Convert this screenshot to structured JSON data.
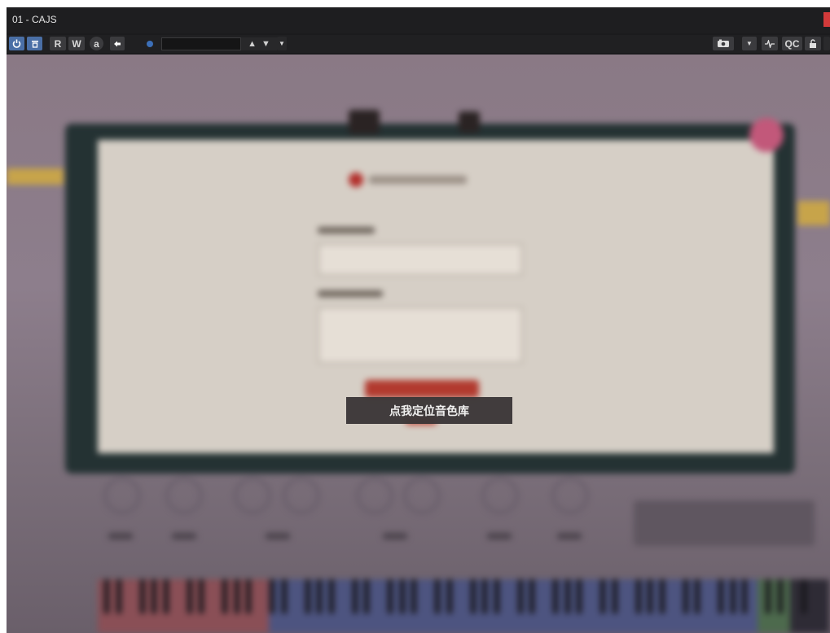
{
  "window": {
    "title": "01 - CAJS"
  },
  "toolbar": {
    "left_buttons": [
      {
        "name": "power-button",
        "icon": "power-icon"
      },
      {
        "name": "bypass-button",
        "icon": "bypass-icon"
      },
      {
        "name": "read-automation-button",
        "label": "R"
      },
      {
        "name": "write-automation-button",
        "label": "W"
      },
      {
        "name": "learn-button",
        "label": "a"
      },
      {
        "name": "arrow-button",
        "icon": "arrow-left-icon"
      }
    ],
    "preset_value": "",
    "right_buttons": [
      {
        "name": "camera-button",
        "icon": "camera-icon"
      },
      {
        "name": "dropdown-button",
        "icon": "chevron-down-icon"
      },
      {
        "name": "waveform-button",
        "icon": "waveform-icon"
      },
      {
        "name": "qc-button",
        "label": "QC"
      },
      {
        "name": "lock-button",
        "icon": "lock-icon"
      }
    ]
  },
  "plugin": {
    "overlay_message": "点我定位音色库"
  },
  "colors": {
    "accent_blue": "#4a6fa6",
    "close_red": "#d23a3a",
    "overlay_bg": "#3a3536"
  }
}
